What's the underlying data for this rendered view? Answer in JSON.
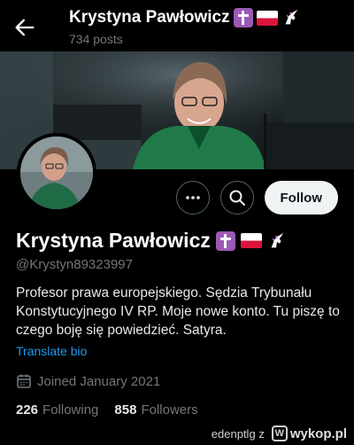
{
  "header": {
    "name": "Krystyna Pawłowicz",
    "posts": "734 posts"
  },
  "profile": {
    "name": "Krystyna Pawłowicz",
    "handle": "@Krystyn89323997",
    "bio": "Profesor prawa europejskiego. Sędzia Trybunału Konstytucyjnego IV RP. Moje nowe konto. Tu piszę to czego boję się powiedzieć. Satyra.",
    "translate_label": "Translate bio",
    "joined": "Joined January 2021",
    "name_emojis": [
      "latin-cross-emoji",
      "poland-flag-emoji",
      "unicorn-emoji"
    ]
  },
  "actions": {
    "follow_label": "Follow",
    "more_icon": "more-icon",
    "search_icon": "search-icon"
  },
  "stats": {
    "following_count": "226",
    "following_label": "Following",
    "followers_count": "858",
    "followers_label": "Followers"
  },
  "watermark": {
    "user": "edenptlg",
    "separator": "z",
    "brand": "wykop.pl"
  },
  "colors": {
    "background": "#000000",
    "accent_link": "#1d9bf0",
    "muted_text": "#71767b",
    "follow_button_bg": "#eff3f4"
  }
}
